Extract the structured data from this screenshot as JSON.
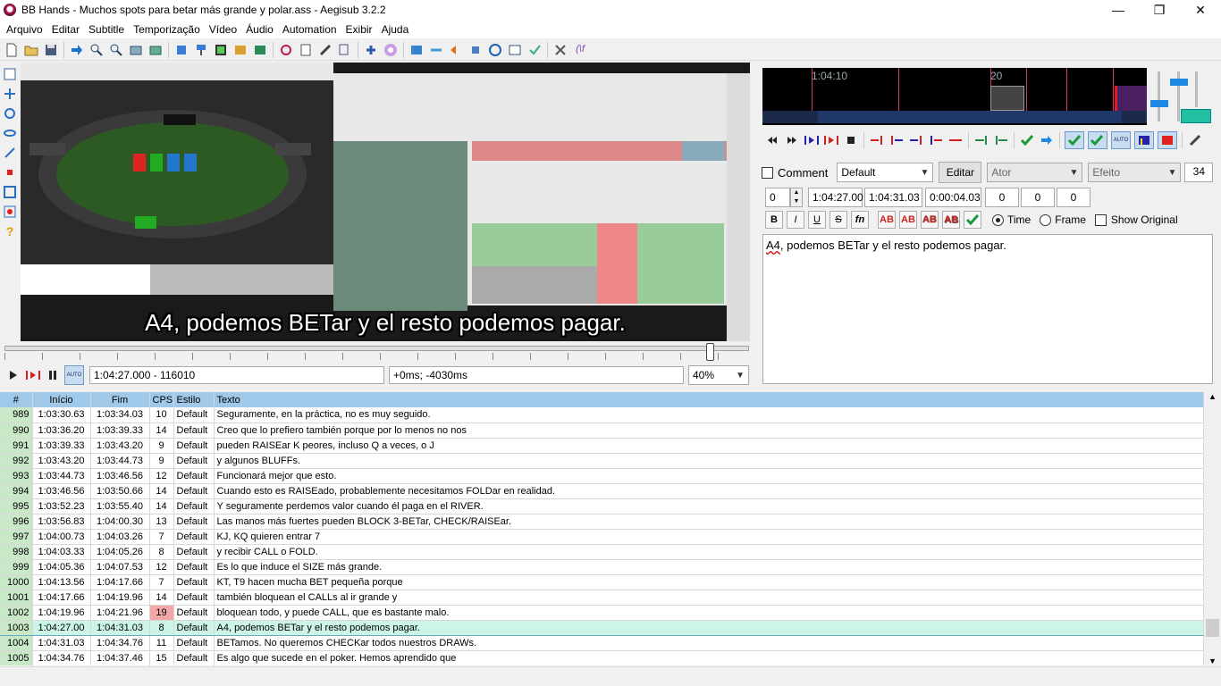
{
  "window": {
    "title": "BB Hands - Muchos spots para betar más grande y polar.ass - Aegisub 3.2.2",
    "minimize": "—",
    "restore": "❐",
    "close": "✕"
  },
  "menu": [
    "Arquivo",
    "Editar",
    "Subtitle",
    "Temporização",
    "Vídeo",
    "Áudio",
    "Automation",
    "Exibir",
    "Ajuda"
  ],
  "video": {
    "subtitle_text": "A4, podemos BETar y el resto podemos pagar.",
    "current_time": "1:04:27.000 - 116010",
    "offset": "+0ms; -4030ms",
    "zoom": "40%",
    "auto_label": "AUTO"
  },
  "audio": {
    "time_label": "1:04:10",
    "frame_label": "20",
    "auto_label": "AUTO"
  },
  "edit": {
    "comment_label": "Comment",
    "style": "Default",
    "edit_button": "Editar",
    "actor_placeholder": "Ator",
    "effect_placeholder": "Efeito",
    "char_count": "34",
    "layer": "0",
    "start": "1:04:27.00",
    "end": "1:04:31.03",
    "duration": "0:00:04.03",
    "margin_l": "0",
    "margin_r": "0",
    "margin_v": "0",
    "bold": "B",
    "italic": "I",
    "underline": "U",
    "strike": "S",
    "fn": "fn",
    "color1": "AB",
    "color2": "AB",
    "color3": "AB",
    "color4": "AB",
    "time_label": "Time",
    "frame_label": "Frame",
    "show_original_label": "Show Original",
    "text_first": "A4",
    "text_rest": ", podemos BETar y el resto podemos pagar."
  },
  "grid": {
    "headers": [
      "#",
      "Início",
      "Fim",
      "CPS",
      "Estilo",
      "Texto"
    ],
    "rows": [
      {
        "n": "989",
        "start": "1:03:30.63",
        "end": "1:03:34.03",
        "cps": "10",
        "style": "Default",
        "text": "Seguramente, en la práctica, no es muy seguido."
      },
      {
        "n": "990",
        "start": "1:03:36.20",
        "end": "1:03:39.33",
        "cps": "14",
        "style": "Default",
        "text": "Creo que lo prefiero también porque por lo menos no nos"
      },
      {
        "n": "991",
        "start": "1:03:39.33",
        "end": "1:03:43.20",
        "cps": "9",
        "style": "Default",
        "text": "pueden RAISEar K peores, incluso Q a veces, o J"
      },
      {
        "n": "992",
        "start": "1:03:43.20",
        "end": "1:03:44.73",
        "cps": "9",
        "style": "Default",
        "text": "y algunos BLUFFs."
      },
      {
        "n": "993",
        "start": "1:03:44.73",
        "end": "1:03:46.56",
        "cps": "12",
        "style": "Default",
        "text": "Funcionará mejor que esto."
      },
      {
        "n": "994",
        "start": "1:03:46.56",
        "end": "1:03:50.66",
        "cps": "14",
        "style": "Default",
        "text": "Cuando esto es RAISEado, probablemente necesitamos FOLDar en realidad."
      },
      {
        "n": "995",
        "start": "1:03:52.23",
        "end": "1:03:55.40",
        "cps": "14",
        "style": "Default",
        "text": "Y seguramente perdemos valor cuando él paga en el RIVER."
      },
      {
        "n": "996",
        "start": "1:03:56.83",
        "end": "1:04:00.30",
        "cps": "13",
        "style": "Default",
        "text": "Las manos más fuertes pueden BLOCK 3-BETar, CHECK/RAISEar."
      },
      {
        "n": "997",
        "start": "1:04:00.73",
        "end": "1:04:03.26",
        "cps": "7",
        "style": "Default",
        "text": "KJ, KQ quieren entrar 7"
      },
      {
        "n": "998",
        "start": "1:04:03.33",
        "end": "1:04:05.26",
        "cps": "8",
        "style": "Default",
        "text": "y recibir CALL o FOLD."
      },
      {
        "n": "999",
        "start": "1:04:05.36",
        "end": "1:04:07.53",
        "cps": "12",
        "style": "Default",
        "text": "Es lo que induce el SIZE más grande."
      },
      {
        "n": "1000",
        "start": "1:04:13.56",
        "end": "1:04:17.66",
        "cps": "7",
        "style": "Default",
        "text": "KT, T9 hacen mucha BET pequeña porque"
      },
      {
        "n": "1001",
        "start": "1:04:17.66",
        "end": "1:04:19.96",
        "cps": "14",
        "style": "Default",
        "text": "también bloquean el CALLs al ir grande y"
      },
      {
        "n": "1002",
        "start": "1:04:19.96",
        "end": "1:04:21.96",
        "cps": "19",
        "style": "Default",
        "text": "bloquean todo, y puede CALL, que es bastante malo."
      },
      {
        "n": "1003",
        "start": "1:04:27.00",
        "end": "1:04:31.03",
        "cps": "8",
        "style": "Default",
        "text": "A4, podemos BETar y el resto podemos pagar."
      },
      {
        "n": "1004",
        "start": "1:04:31.03",
        "end": "1:04:34.76",
        "cps": "11",
        "style": "Default",
        "text": "BETamos. No queremos CHECKar todos nuestros DRAWs."
      },
      {
        "n": "1005",
        "start": "1:04:34.76",
        "end": "1:04:37.46",
        "cps": "15",
        "style": "Default",
        "text": "Es algo que sucede en el poker. Hemos aprendido que"
      }
    ]
  },
  "colors": {
    "grid_header": "#a0c8e8",
    "row_number_bg": "#c8e8c8",
    "active_row_bg": "#ccf5e6",
    "cps_warning_bg": "#f2a8a8"
  }
}
